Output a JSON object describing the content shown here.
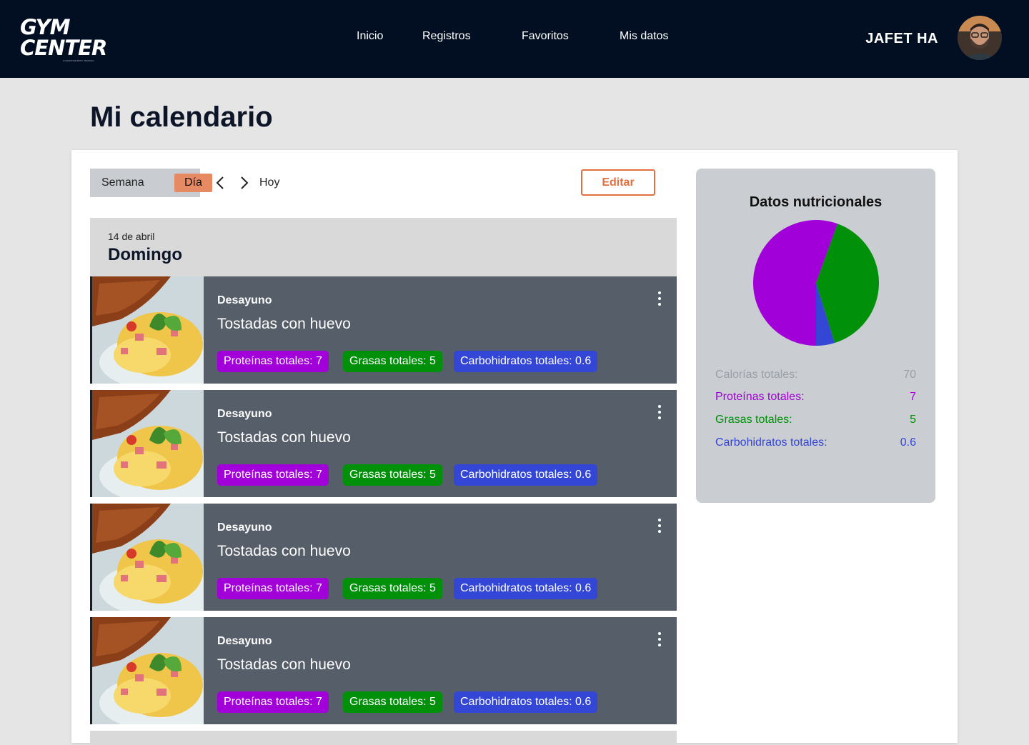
{
  "header": {
    "logo_line1": "GYM",
    "logo_line2": "CENTER",
    "logo_tagline": "GYMCENTER BODY TRAINING",
    "nav": [
      "Inicio",
      "Registros",
      "Favoritos",
      "Mis datos"
    ],
    "user_name": "JAFET HA"
  },
  "page": {
    "title": "Mi calendario"
  },
  "toolbar": {
    "week_label": "Semana",
    "day_label": "Día",
    "today_label": "Hoy",
    "edit_label": "Editar"
  },
  "day": {
    "date": "14 de abril",
    "name": "Domingo"
  },
  "meals": [
    {
      "kind": "Desayuno",
      "name": "Tostadas con huevo",
      "protein": "Proteínas totales: 7",
      "fat": "Grasas totales: 5",
      "carbs": "Carbohidratos totales: 0.6"
    },
    {
      "kind": "Desayuno",
      "name": "Tostadas con huevo",
      "protein": "Proteínas totales: 7",
      "fat": "Grasas totales: 5",
      "carbs": "Carbohidratos totales: 0.6"
    },
    {
      "kind": "Desayuno",
      "name": "Tostadas con huevo",
      "protein": "Proteínas totales: 7",
      "fat": "Grasas totales: 5",
      "carbs": "Carbohidratos totales: 0.6"
    },
    {
      "kind": "Desayuno",
      "name": "Tostadas con huevo",
      "protein": "Proteínas totales: 7",
      "fat": "Grasas totales: 5",
      "carbs": "Carbohidratos totales: 0.6"
    }
  ],
  "nutrition": {
    "title": "Datos nutricionales",
    "rows": [
      {
        "label": "Calorías totales:",
        "value": "70",
        "color": "#9aa0a8"
      },
      {
        "label": "Proteínas totales:",
        "value": "7",
        "color": "#a100d8"
      },
      {
        "label": "Grasas totales:",
        "value": "5",
        "color": "#00900a"
      },
      {
        "label": "Carbohidratos totales:",
        "value": "0.6",
        "color": "#3346d6"
      }
    ]
  },
  "chart_data": {
    "type": "pie",
    "categories": [
      "Proteínas totales",
      "Grasas totales",
      "Carbohidratos totales"
    ],
    "values": [
      7,
      5,
      0.6
    ],
    "colors": [
      "#a100d8",
      "#00900a",
      "#3346d6"
    ],
    "title": "Datos nutricionales"
  },
  "colors": {
    "accent": "#e07040",
    "header_bg": "#020f23",
    "meal_bg": "#565e69"
  }
}
